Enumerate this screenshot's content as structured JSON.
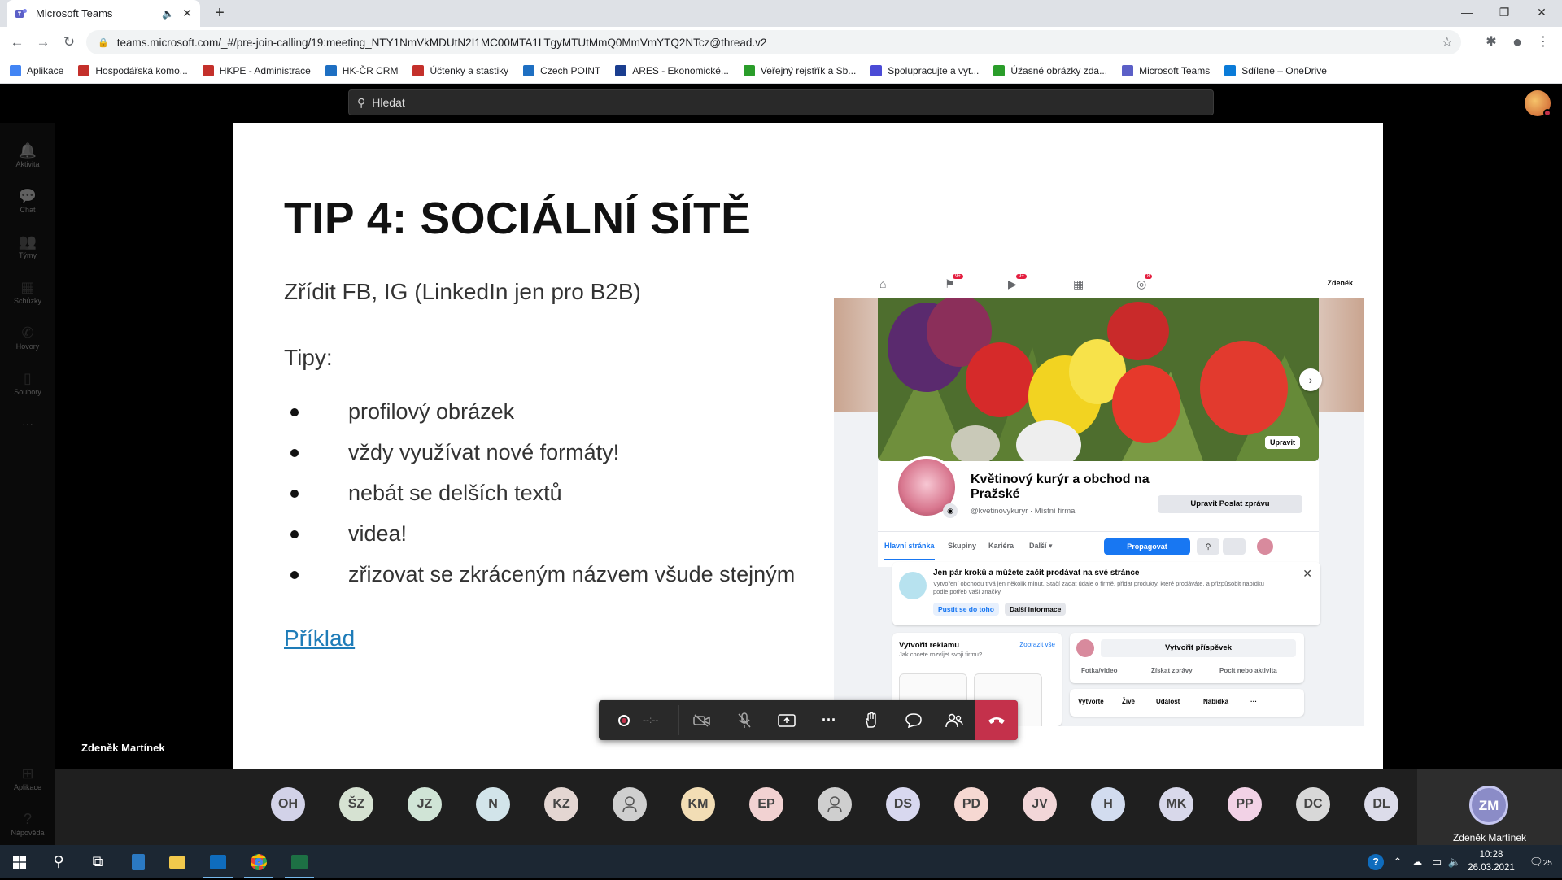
{
  "browser": {
    "tab_title": "Microsoft Teams",
    "url": "teams.microsoft.com/_#/pre-join-calling/19:meeting_NTY1NmVkMDUtN2I1MC00MTA1LTgyMTUtMmQ0MmVmYTQ2NTcz@thread.v2",
    "bookmarks": [
      {
        "label": "Aplikace",
        "color": "#4285f4"
      },
      {
        "label": "Hospodářská komo...",
        "color": "#c4302b"
      },
      {
        "label": "HKPE - Administrace",
        "color": "#c4302b"
      },
      {
        "label": "HK-ČR CRM",
        "color": "#1e6fc2"
      },
      {
        "label": "Účtenky a stastiky",
        "color": "#c4302b"
      },
      {
        "label": "Czech POINT",
        "color": "#1e6fc2"
      },
      {
        "label": "ARES - Ekonomické...",
        "color": "#1a3d8f"
      },
      {
        "label": "Veřejný rejstřík a Sb...",
        "color": "#2a9d2a"
      },
      {
        "label": "Spolupracujte a vyt...",
        "color": "#4b4bd6"
      },
      {
        "label": "Úžasné obrázky zda...",
        "color": "#2a9d2a"
      },
      {
        "label": "Microsoft Teams",
        "color": "#5b5fc7"
      },
      {
        "label": "Sdílene – OneDrive",
        "color": "#0a7bd8"
      }
    ]
  },
  "teams": {
    "search_label": "Hledat",
    "rail": [
      {
        "label": "Aktivita",
        "icon": "bell-icon"
      },
      {
        "label": "Chat",
        "icon": "chat-icon"
      },
      {
        "label": "Týmy",
        "icon": "teams-icon"
      },
      {
        "label": "Schůzky",
        "icon": "calendar-icon"
      },
      {
        "label": "Hovory",
        "icon": "phone-icon"
      },
      {
        "label": "Soubory",
        "icon": "file-icon"
      }
    ],
    "rail_more": "···",
    "rail_bottom": [
      {
        "label": "Aplikace",
        "icon": "apps-icon"
      },
      {
        "label": "Nápověda",
        "icon": "help-icon"
      }
    ],
    "presenter_name": "Zdeněk Martínek",
    "call_timer": "--:--",
    "participants": [
      {
        "initials": "OH",
        "color": "#d2d2e8"
      },
      {
        "initials": "ŠZ",
        "color": "#d6e2d2"
      },
      {
        "initials": "JZ",
        "color": "#d0e4d6"
      },
      {
        "initials": "N",
        "color": "#d2e4ea"
      },
      {
        "initials": "KZ",
        "color": "#e4d6d2"
      },
      {
        "initials": "",
        "color": "#cfcfcf"
      },
      {
        "initials": "KM",
        "color": "#f2ddb5"
      },
      {
        "initials": "EP",
        "color": "#f2d2d2"
      },
      {
        "initials": "",
        "color": "#cfcfcf"
      },
      {
        "initials": "DS",
        "color": "#d8d8ef"
      },
      {
        "initials": "PD",
        "color": "#f6d8d2"
      },
      {
        "initials": "JV",
        "color": "#f2d6d8"
      },
      {
        "initials": "H",
        "color": "#d2dcef"
      },
      {
        "initials": "MK",
        "color": "#d8d8ea"
      },
      {
        "initials": "PP",
        "color": "#f2d2e6"
      },
      {
        "initials": "DC",
        "color": "#d8d8d8"
      },
      {
        "initials": "DL",
        "color": "#dcdcea"
      }
    ],
    "self": {
      "initials": "ZM",
      "name": "Zdeněk Martínek"
    }
  },
  "slide": {
    "title": "TIP 4: SOCIÁLNÍ SÍTĚ",
    "subtitle": "Zřídit FB, IG (LinkedIn jen pro B2B)",
    "tips_heading": "Tipy:",
    "bullets": [
      "profilový obrázek",
      "vždy využívat nové formáty!",
      "nebát se delších textů",
      "videa!",
      "zřizovat se zkráceným názvem všude stejným"
    ],
    "link": "Příklad"
  },
  "fb": {
    "badges": [
      "9+",
      "9+",
      "8"
    ],
    "user": "Zdeněk",
    "edit_cover": "Upravit",
    "page_name": "Květinový kurýr a obchod na Pražské",
    "handle": "@kvetinovykuryr · Místní firma",
    "edit_button": "Upravit Poslat zprávu",
    "tabs": [
      "Hlavní stránka",
      "Skupiny",
      "Kariéra",
      "Další ▾"
    ],
    "promote": "Propagovat",
    "notice_title": "Jen pár kroků a můžete začít prodávat na své stránce",
    "notice_text": "Vytvoření obchodu trvá jen několik minut. Stačí zadat údaje o firmě, přidat produkty, které prodáváte, a přizpůsobit nabídku podle potřeb vaší značky.",
    "notice_btn1": "Pustit se do toho",
    "notice_btn2": "Další informace",
    "ad_title": "Vytvořit reklamu",
    "ad_link": "Zobrazit vše",
    "ad_sub": "Jak chcete rozvíjet svoji firmu?",
    "post_btn": "Vytvořit příspěvek",
    "post_opts": [
      "Fotka/video",
      "Získat zprávy",
      "Pocit nebo aktivita"
    ],
    "create_label": "Vytvořte",
    "create_opts": [
      "Živě",
      "Událost",
      "Nabídka",
      "···"
    ]
  },
  "taskbar": {
    "time": "10:28",
    "date": "26.03.2021",
    "notifications": "25"
  }
}
